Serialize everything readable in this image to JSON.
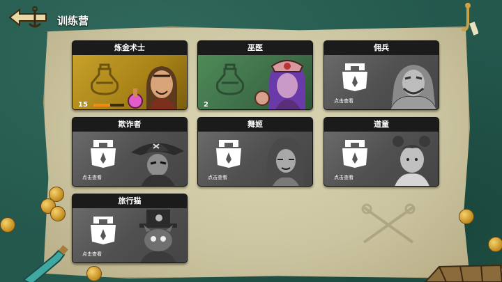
{
  "header": {
    "title": "训练营",
    "back_icon": "anchor-back-icon"
  },
  "colors": {
    "gold_card": "#b99020",
    "green_card": "#3f7048",
    "locked_card": "#565656",
    "level_bar": "#f08a14"
  },
  "cards": [
    {
      "name": "炼金术士",
      "level": "15",
      "progress": 0.55,
      "state": "unlocked",
      "theme": "gold"
    },
    {
      "name": "巫医",
      "level": "2",
      "progress": 0.0,
      "state": "unlocked",
      "theme": "green"
    },
    {
      "name": "佣兵",
      "state": "locked",
      "hint": "点击查看"
    },
    {
      "name": "欺诈者",
      "state": "locked",
      "hint": "点击查看"
    },
    {
      "name": "舞姬",
      "state": "locked",
      "hint": "点击查看"
    },
    {
      "name": "道童",
      "state": "locked",
      "hint": "点击查看"
    },
    {
      "name": "旅行猫",
      "state": "locked",
      "hint": "点击查看"
    }
  ]
}
